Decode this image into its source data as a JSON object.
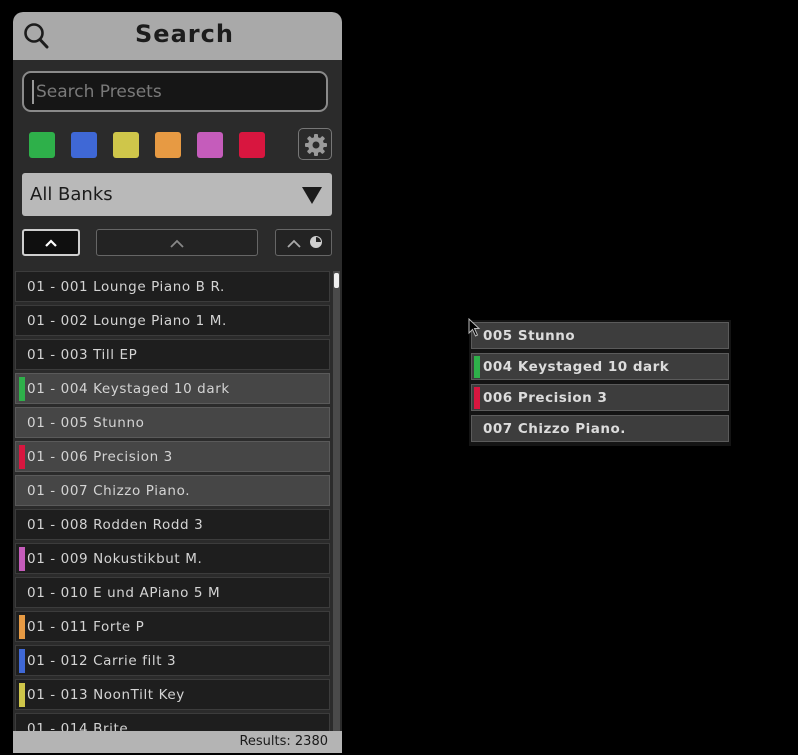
{
  "search_panel": {
    "title": "Search",
    "search_placeholder": "Search Presets",
    "color_filters": [
      {
        "name": "green",
        "color": "#2eb04a"
      },
      {
        "name": "blue",
        "color": "#3f68d6"
      },
      {
        "name": "yellow",
        "color": "#cfc64a"
      },
      {
        "name": "orange",
        "color": "#e79a43"
      },
      {
        "name": "magenta",
        "color": "#c55cbb"
      },
      {
        "name": "red",
        "color": "#d8163f"
      }
    ],
    "settings_icon": "gear-icon",
    "bank_select": {
      "selected": "All Banks"
    },
    "sort_buttons": [
      "sort-ascending",
      "sort-toggle",
      "sort-by-recent"
    ]
  },
  "presets": [
    {
      "text": "01 - 001  Lounge Piano B R.",
      "marker": null,
      "highlight": false
    },
    {
      "text": "01 - 002  Lounge Piano 1 M.",
      "marker": null,
      "highlight": false
    },
    {
      "text": "01 - 003  Till EP",
      "marker": null,
      "highlight": false
    },
    {
      "text": "01 - 004  Keystaged 10 dark",
      "marker": "#2eb04a",
      "highlight": true
    },
    {
      "text": "01 - 005  Stunno",
      "marker": null,
      "highlight": true
    },
    {
      "text": "01 - 006  Precision 3",
      "marker": "#d8163f",
      "highlight": true
    },
    {
      "text": "01 - 007  Chizzo Piano.",
      "marker": null,
      "highlight": true
    },
    {
      "text": "01 - 008  Rodden Rodd 3",
      "marker": null,
      "highlight": false
    },
    {
      "text": "01 - 009  Nokustikbut M.",
      "marker": "#c55cbb",
      "highlight": false
    },
    {
      "text": "01 - 010  E und APiano 5 M",
      "marker": null,
      "highlight": false
    },
    {
      "text": "01 - 011  Forte P",
      "marker": "#e79a43",
      "highlight": false
    },
    {
      "text": "01 - 012  Carrie filt 3",
      "marker": "#3f68d6",
      "highlight": false
    },
    {
      "text": "01 - 013  NoonTilt Key",
      "marker": "#cfc64a",
      "highlight": false
    },
    {
      "text": "01 - 014  Brite",
      "marker": null,
      "highlight": false
    }
  ],
  "results": "Results: 2380",
  "drag_selection": [
    {
      "text": "005  Stunno",
      "marker": null
    },
    {
      "text": "004  Keystaged 10 dark",
      "marker": "#2eb04a"
    },
    {
      "text": "006  Precision 3",
      "marker": "#d8163f"
    },
    {
      "text": "007  Chizzo Piano.",
      "marker": null
    }
  ]
}
